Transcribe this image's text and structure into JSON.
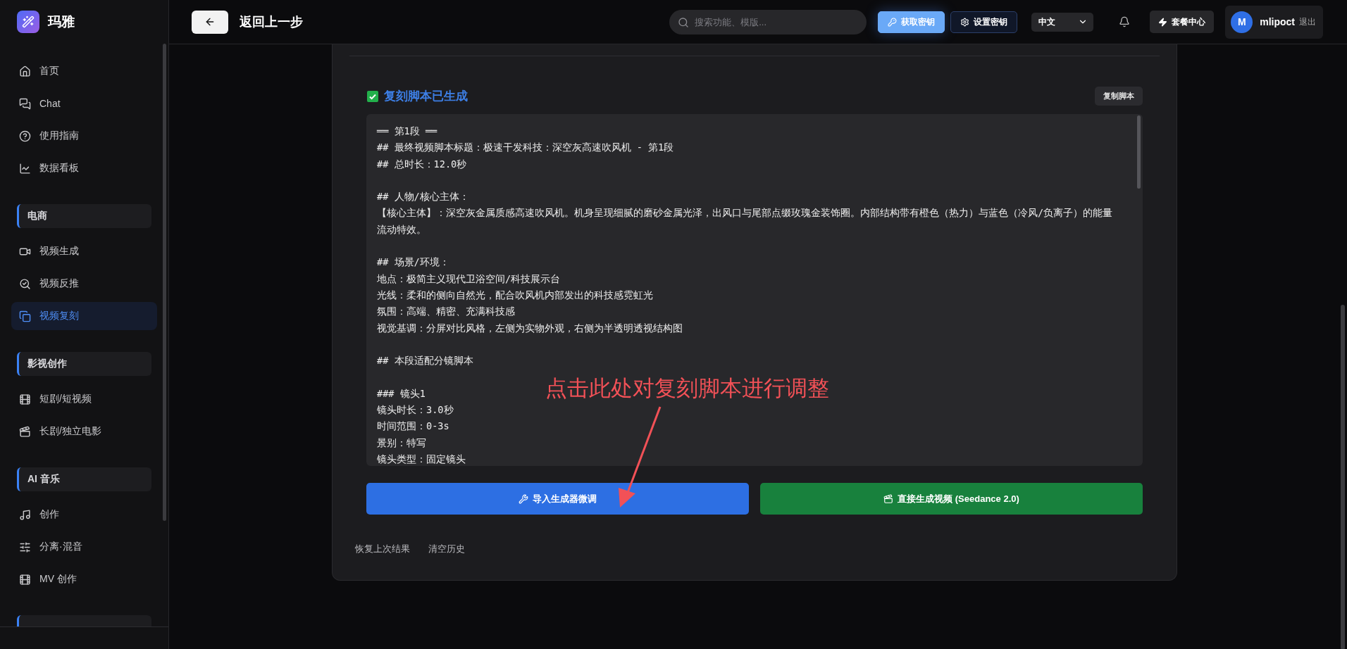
{
  "brand": {
    "name": "玛雅"
  },
  "sidebar": {
    "groups": [
      {
        "items": [
          {
            "label": "首页",
            "selected": false
          },
          {
            "label": "Chat",
            "selected": false
          },
          {
            "label": "使用指南",
            "selected": false
          },
          {
            "label": "数据看板",
            "selected": false
          }
        ]
      },
      {
        "title": "电商",
        "items": [
          {
            "label": "视频生成",
            "selected": false
          },
          {
            "label": "视频反推",
            "selected": false
          },
          {
            "label": "视频复刻",
            "selected": true
          }
        ]
      },
      {
        "title": "影视创作",
        "items": [
          {
            "label": "短剧/短视频",
            "selected": false
          },
          {
            "label": "长剧/独立电影",
            "selected": false
          }
        ]
      },
      {
        "title": "AI 音乐",
        "items": [
          {
            "label": "创作",
            "selected": false
          },
          {
            "label": "分离·混音",
            "selected": false
          },
          {
            "label": "MV 创作",
            "selected": false
          }
        ]
      }
    ]
  },
  "topbar": {
    "back_title": "返回上一步",
    "search_placeholder": "搜索功能、模版...",
    "get_key": "获取密钥",
    "set_key": "设置密钥",
    "language": "中文",
    "plan": "套餐中心",
    "user": {
      "initial": "M",
      "name": "mlipoct",
      "logout": "退出"
    }
  },
  "result": {
    "title": "复刻脚本已生成",
    "copy_button": "复制脚本",
    "script": [
      [
        "══ 第1段 ══",
        "## 最终视频脚本标题：极速干发科技：深空灰高速吹风机 - 第1段",
        "## 总时长：12.0秒"
      ],
      [
        "## 人物/核心主体：",
        "【核心主体】：深空灰金属质感高速吹风机。机身呈现细腻的磨砂金属光泽，出风口与尾部点缀玫瑰金装饰圈。内部结构带有橙色（热力）与蓝色（冷风/负离子）的能量流动特效。"
      ],
      [
        "## 场景/环境：",
        "地点：极简主义现代卫浴空间/科技展示台",
        "光线：柔和的侧向自然光，配合吹风机内部发出的科技感霓虹光",
        "氛围：高端、精密、充满科技感",
        "视觉基调：分屏对比风格，左侧为实物外观，右侧为半透明透视结构图"
      ],
      [
        "## 本段适配分镜脚本"
      ],
      [
        "### 镜头1",
        "镜头时长：3.0秒",
        "时间范围：0-3s",
        "景别：特写",
        "镜头类型：固定镜头"
      ]
    ],
    "buttons": [
      {
        "kind": "primary",
        "label": "导入生成器微调"
      },
      {
        "kind": "success",
        "label": "直接生成视频 (Seedance 2.0)"
      }
    ],
    "links": [
      "恢复上次结果",
      "清空历史"
    ]
  },
  "annotation": {
    "text": "点击此处对复刻脚本进行调整"
  }
}
